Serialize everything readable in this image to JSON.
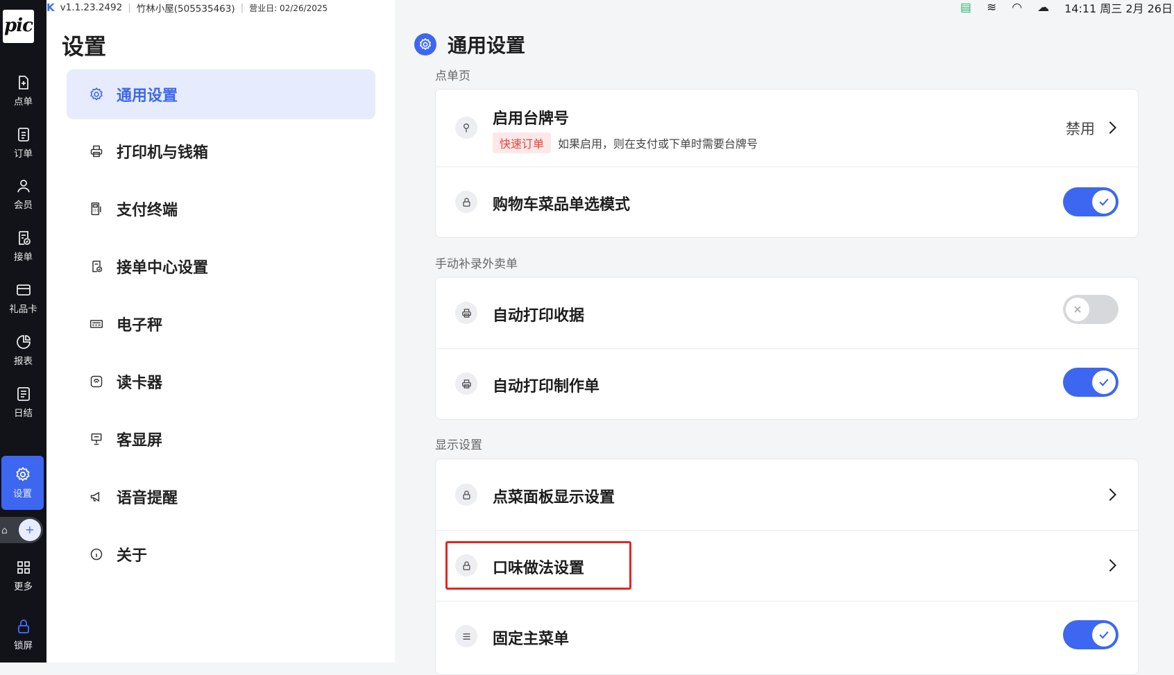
{
  "top_bar": {
    "version": "v1.1.23.2492",
    "store": "竹林小屋(505535463)",
    "business_day": "营业日: 02/26/2025",
    "datetime": "14:11 周三 2月 26日"
  },
  "rail": {
    "logo_text": "pic",
    "items": [
      {
        "label": "点单",
        "icon": "add-document-icon"
      },
      {
        "label": "订单",
        "icon": "order-list-icon"
      },
      {
        "label": "会员",
        "icon": "member-icon"
      },
      {
        "label": "接单",
        "icon": "accept-order-icon"
      },
      {
        "label": "礼品卡",
        "icon": "gift-card-icon"
      },
      {
        "label": "报表",
        "icon": "pie-chart-icon"
      },
      {
        "label": "日结",
        "icon": "daily-close-icon"
      },
      {
        "label": "设置",
        "icon": "gear-icon"
      },
      {
        "label": "更多",
        "icon": "grid-icon"
      },
      {
        "label": "锁屏",
        "icon": "lock-icon"
      }
    ],
    "active": "设置"
  },
  "settings": {
    "title": "设置",
    "menu": [
      {
        "label": "通用设置",
        "icon": "gear-icon"
      },
      {
        "label": "打印机与钱箱",
        "icon": "printer-icon"
      },
      {
        "label": "支付终端",
        "icon": "terminal-icon"
      },
      {
        "label": "接单中心设置",
        "icon": "order-center-icon"
      },
      {
        "label": "电子秤",
        "icon": "scale-icon"
      },
      {
        "label": "读卡器",
        "icon": "card-reader-icon"
      },
      {
        "label": "客显屏",
        "icon": "customer-display-icon"
      },
      {
        "label": "语音提醒",
        "icon": "megaphone-icon"
      },
      {
        "label": "关于",
        "icon": "info-icon"
      }
    ],
    "active": "通用设置"
  },
  "content": {
    "title": "通用设置",
    "section1_label": "点单页",
    "table_number": {
      "title": "启用台牌号",
      "tag": "快速订单",
      "desc": "如果启用，则在支付或下单时需要台牌号",
      "value": "禁用"
    },
    "cart_single": {
      "title": "购物车菜品单选模式",
      "enabled": true
    },
    "section2_label": "手动补录外卖单",
    "auto_receipt": {
      "title": "自动打印收据",
      "enabled": false
    },
    "auto_kitchen": {
      "title": "自动打印制作单",
      "enabled": true
    },
    "section3_label": "显示设置",
    "menu_panel": {
      "title": "点菜面板显示设置"
    },
    "flavor": {
      "title": "口味做法设置"
    },
    "fixed_menu": {
      "title": "固定主菜单",
      "enabled": true
    },
    "accent_color": "#3d67f0",
    "highlight_color": "#e8231f"
  }
}
